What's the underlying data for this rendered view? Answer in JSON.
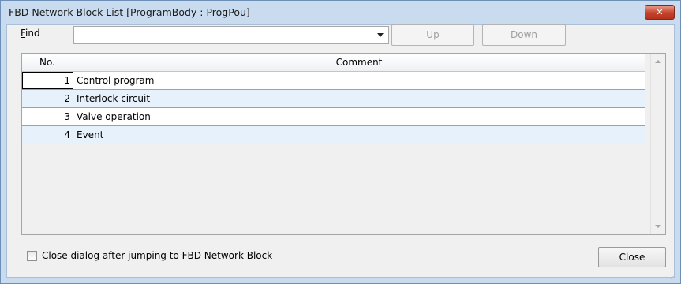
{
  "window": {
    "title": "FBD Network Block List [ProgramBody : ProgPou]",
    "close_glyph": "✕"
  },
  "find": {
    "label_mnemonic": "F",
    "label_rest": "ind",
    "value": "",
    "up_label_mnemonic": "U",
    "up_label_rest": "p",
    "down_label_mnemonic": "D",
    "down_label_rest": "own"
  },
  "table": {
    "columns": [
      "No.",
      "Comment"
    ],
    "rows": [
      {
        "no": "1",
        "comment": "Control program"
      },
      {
        "no": "2",
        "comment": "Interlock circuit"
      },
      {
        "no": "3",
        "comment": "Valve operation"
      },
      {
        "no": "4",
        "comment": "Event"
      }
    ]
  },
  "footer": {
    "checkbox_label_pre": "Close dialog after jumping to FBD ",
    "checkbox_label_mnemonic": "N",
    "checkbox_label_post": "etwork Block",
    "checkbox_checked": false,
    "close_label": "Close"
  },
  "colors": {
    "frame": "#c9dcef",
    "row_alt": "#e6f1fb"
  }
}
